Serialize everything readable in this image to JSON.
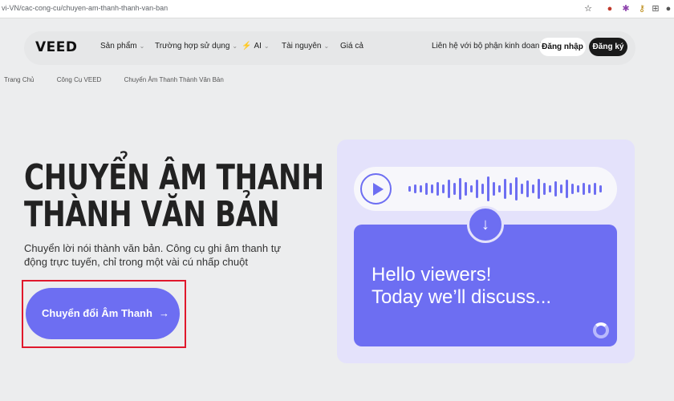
{
  "browser": {
    "url": "vi-VN/cac-cong-cu/chuyen-am-thanh-thanh-van-ban",
    "icons": [
      "star-icon",
      "extension-red-icon",
      "extension-purple-icon",
      "key-icon",
      "puzzle-icon",
      "profile-icon"
    ]
  },
  "nav": {
    "logo": "VEED",
    "items": [
      "Sản phẩm",
      "Trường hợp sử dụng",
      "AI",
      "Tài nguyên",
      "Giá cả"
    ],
    "contact": "Liên hệ với bộ phận kinh doanh",
    "login": "Đăng nhập",
    "signup": "Đăng ký"
  },
  "breadcrumb": [
    "Trang Chủ",
    "Công Cụ VEED",
    "Chuyển Âm Thanh Thành Văn Bản"
  ],
  "hero": {
    "title_line1": "CHUYỂN ÂM THANH",
    "title_line2": "THÀNH VĂN BẢN",
    "subtitle": "Chuyển lời nói thành văn bản. Công cụ ghi âm thanh tự động trực tuyến, chỉ trong một vài cú nhấp chuột",
    "cta_label": "Chuyển đổi Âm Thanh",
    "cta_arrow": "→"
  },
  "illustration": {
    "caption_line1": "Hello viewers!",
    "caption_line2": "Today we’ll discuss...",
    "down_arrow": "↓"
  },
  "colors": {
    "accent": "#6d6ef2",
    "highlight_box": "#e0182c",
    "panel_bg": "#e4e2fb"
  }
}
